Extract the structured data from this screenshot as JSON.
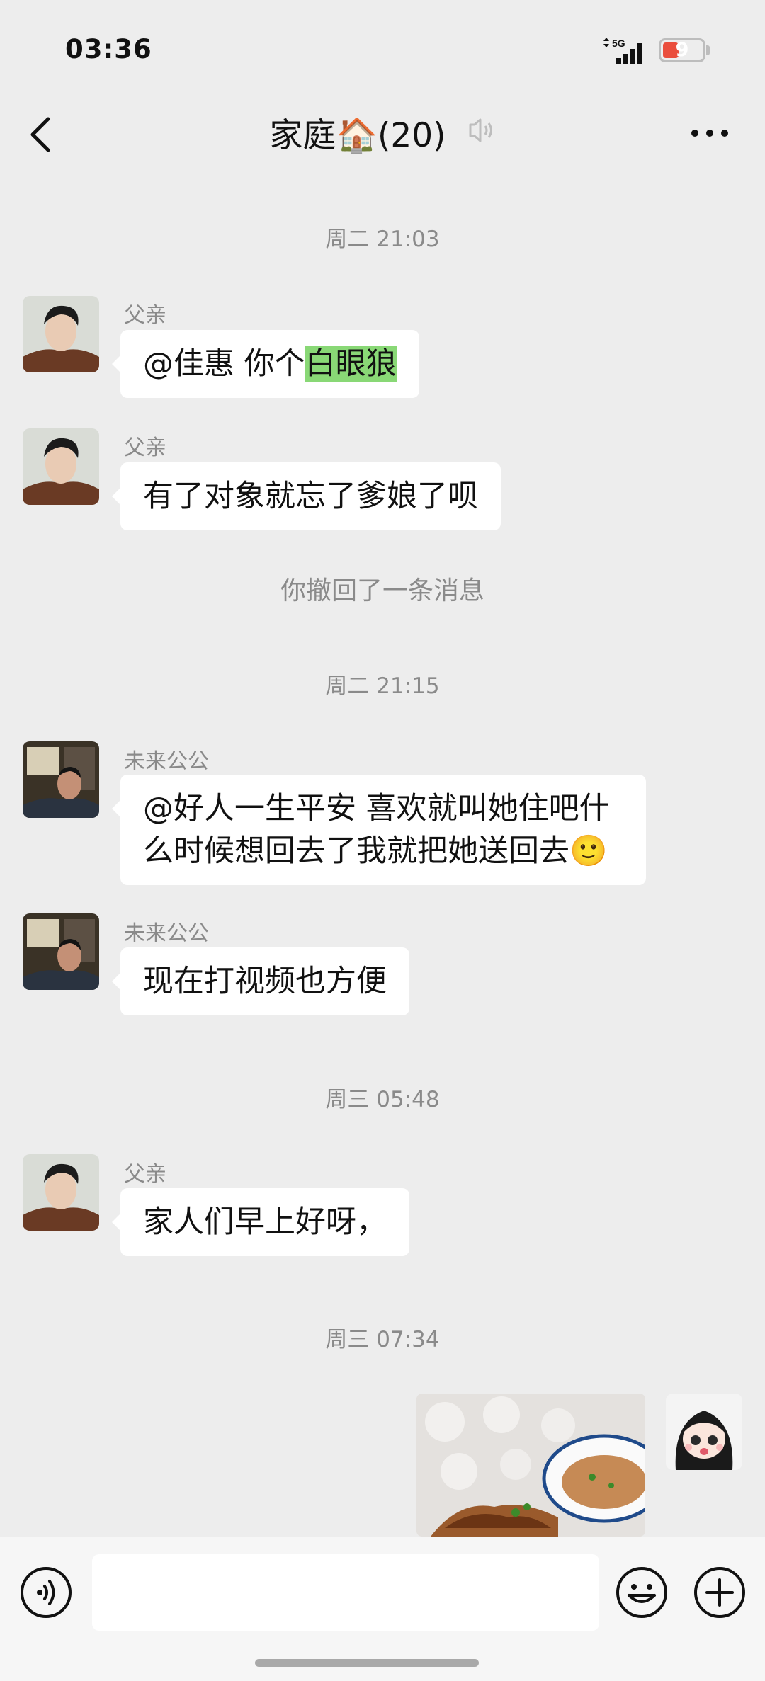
{
  "status_bar": {
    "time": "03:36",
    "network": "5G",
    "battery": "9"
  },
  "nav": {
    "title": "家庭🏠(20)"
  },
  "messages": [
    {
      "type": "time",
      "text": "周二 21:03"
    },
    {
      "type": "text",
      "sender": "父亲",
      "prefix": "@佳惠 你个",
      "highlight": "白眼狼"
    },
    {
      "type": "text",
      "sender": "父亲",
      "text": "有了对象就忘了爹娘了呗"
    },
    {
      "type": "system",
      "text": "你撤回了一条消息"
    },
    {
      "type": "time",
      "text": "周二 21:15"
    },
    {
      "type": "text",
      "sender": "未来公公",
      "line1": "@好人一生平安  喜欢就叫她住吧什",
      "line2": "么时候想回去了我就把她送回去🙂"
    },
    {
      "type": "text",
      "sender": "未来公公",
      "text": "现在打视频也方便"
    },
    {
      "type": "time",
      "text": "周三 05:48"
    },
    {
      "type": "text",
      "sender": "父亲",
      "text": "家人们早上好呀，"
    },
    {
      "type": "time",
      "text": "周三 07:34"
    },
    {
      "type": "image",
      "sender": "self"
    }
  ],
  "input": {
    "placeholder": ""
  },
  "colors": {
    "background": "#ededed",
    "bubble": "#ffffff",
    "highlight": "#89d876",
    "meta_text": "#8a8a8a"
  }
}
